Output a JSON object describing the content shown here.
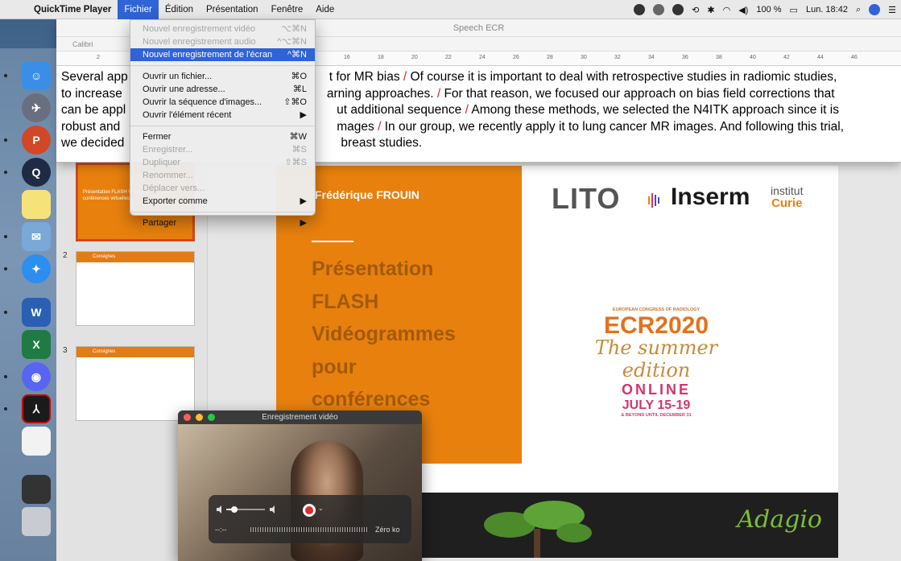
{
  "menubar": {
    "app": "QuickTime Player",
    "items": [
      "Fichier",
      "Édition",
      "Présentation",
      "Fenêtre",
      "Aide"
    ],
    "battery": "100 %",
    "clock": "Lun. 18:42"
  },
  "text_window": {
    "title": "Speech ECR",
    "font": "Calibri",
    "ruler": [
      "2",
      "16",
      "18",
      "20",
      "22",
      "24",
      "26",
      "28",
      "30",
      "32",
      "34",
      "36",
      "38",
      "40",
      "42",
      "44",
      "46"
    ],
    "lines": [
      {
        "a": "Several app",
        "b": "t for MR bias  ",
        "s": "/",
        "c": " Of course it is important to deal with retrospective studies in radiomic studies,"
      },
      {
        "a": "to increase",
        "b": "arning approaches. ",
        "s": "/",
        "c": " For that reason, we focused our approach on bias field corrections that"
      },
      {
        "a": "can be appl",
        "b": "ut additional sequence ",
        "s": "/",
        "c": " Among these methods, we selected the N4ITK approach since it is"
      },
      {
        "a": "robust and",
        "b": "mages ",
        "s": "/",
        "c": " In our group, we recently apply it to lung cancer MR images. And following this trial,"
      },
      {
        "a": "we decided",
        "b": "breast studies.",
        "s": "",
        "c": ""
      }
    ]
  },
  "file_menu": {
    "items": [
      {
        "label": "Nouvel enregistrement vidéo",
        "shortcut": "⌥⌘N",
        "disabled": true
      },
      {
        "label": "Nouvel enregistrement audio",
        "shortcut": "^⌥⌘N",
        "disabled": true
      },
      {
        "label": "Nouvel enregistrement de l'écran",
        "shortcut": "^⌘N",
        "highlighted": true
      },
      {
        "sep": true
      },
      {
        "label": "Ouvrir un fichier...",
        "shortcut": "⌘O"
      },
      {
        "label": "Ouvrir une adresse...",
        "shortcut": "⌘L"
      },
      {
        "label": "Ouvrir la séquence d'images...",
        "shortcut": "⇧⌘O"
      },
      {
        "label": "Ouvrir l'élément récent",
        "shortcut": "▶"
      },
      {
        "sep": true
      },
      {
        "label": "Fermer",
        "shortcut": "⌘W"
      },
      {
        "label": "Enregistrer...",
        "shortcut": "⌘S",
        "disabled": true
      },
      {
        "label": "Dupliquer",
        "shortcut": "⇧⌘S",
        "disabled": true
      },
      {
        "label": "Renommer...",
        "shortcut": "",
        "disabled": true
      },
      {
        "label": "Déplacer vers...",
        "shortcut": "",
        "disabled": true
      },
      {
        "label": "Exporter comme",
        "shortcut": "▶"
      },
      {
        "sep": true
      },
      {
        "label": "Partager",
        "shortcut": "▶"
      }
    ]
  },
  "slide_panel": {
    "thumbnails": [
      {
        "num": "",
        "title": "Présentation FLASH Vidéogrammes pour conférences virtuelles"
      },
      {
        "num": "2",
        "title": "Consignes"
      },
      {
        "num": "3",
        "title": "Consignes"
      }
    ]
  },
  "slide": {
    "author": "Frédérique FROUIN",
    "title_lines": [
      "Présentation",
      "FLASH",
      "Vidéogrammes",
      "pour",
      "conférences"
    ],
    "logo_lito": "LITO",
    "logo_inserm": "Inserm",
    "logo_curie_top": "institut",
    "logo_curie_bottom": "Curie",
    "ecr": {
      "congress": "EUROPEAN CONGRESS OF RADIOLOGY",
      "num": "ECR2020",
      "summer": "The summer edition",
      "online": "ONLINE",
      "dates": "JULY 15-19",
      "beyond": "& BEYOND UNTIL DECEMBER 31"
    },
    "footer_brand": "Adagio"
  },
  "video_window": {
    "title": "Enregistrement vidéo",
    "time": "--:--",
    "size": "Zéro ko"
  },
  "colors": {
    "accent": "#2f63d6",
    "orange": "#e8800e",
    "red_slash": "#e2261b"
  }
}
